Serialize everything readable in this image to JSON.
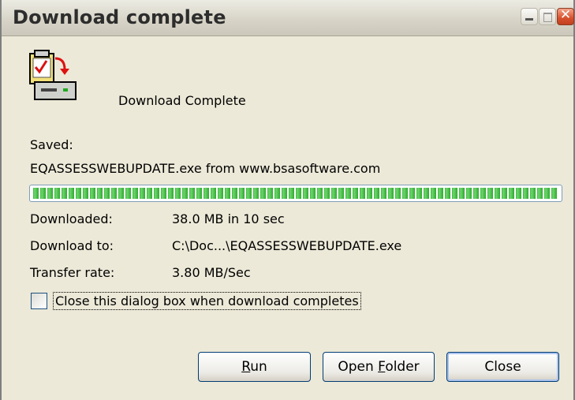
{
  "window": {
    "title": "Download complete"
  },
  "status": {
    "heading": "Download Complete"
  },
  "saved": {
    "label": "Saved:",
    "file": "EQASSESSWEBUPDATE.exe from www.bsasoftware.com"
  },
  "progress": {
    "percent": 100
  },
  "details": {
    "downloaded_label": "Downloaded:",
    "downloaded_value": "38.0 MB in 10 sec",
    "download_to_label": "Download to:",
    "download_to_value": "C:\\Doc...\\EQASSESSWEBUPDATE.exe",
    "transfer_rate_label": "Transfer rate:",
    "transfer_rate_value": "3.80 MB/Sec"
  },
  "options": {
    "close_when_complete_label": "Close this dialog box when download completes",
    "close_when_complete_checked": false
  },
  "buttons": {
    "run": {
      "accel": "R",
      "rest": "un"
    },
    "open_folder": {
      "pre": "Open ",
      "accel": "F",
      "rest": "older"
    },
    "close": "Close"
  },
  "colors": {
    "titlebar": "#d8d5c8",
    "dialog_bg": "#ece9d8",
    "progress_green": "#3cb83c",
    "button_border": "#003c74"
  },
  "icons": {
    "status": "download-complete-icon",
    "minimize": "minimize-icon",
    "maximize": "maximize-icon",
    "close": "close-icon"
  }
}
